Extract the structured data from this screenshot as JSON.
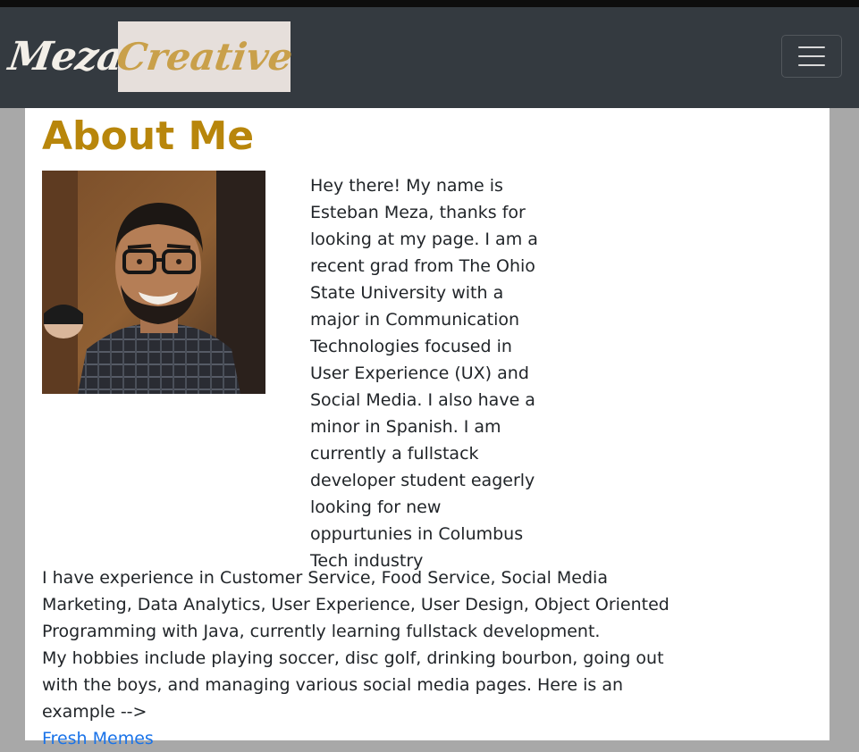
{
  "navbar": {
    "brand_part1": "Meza",
    "brand_part2": "Creative",
    "toggle_icon": "hamburger-menu-icon"
  },
  "main": {
    "title": "About Me",
    "photo_alt": "Esteban Meza",
    "bio": "Hey there! My name is Esteban Meza, thanks for looking at my page. I am a recent grad from The Ohio State University with a major in Communication Technologies focused in User Experience (UX) and Social Media. I also have a minor in Spanish. I am currently a fullstack developer student eagerly looking for new oppurtunies in Columbus Tech industry",
    "experience": "I have experience in Customer Service, Food Service, Social Media Marketing, Data Analytics, User Experience, User Design, Object Oriented Programming with Java, currently learning fullstack development.",
    "hobbies": "My hobbies include playing soccer, disc golf, drinking bourbon, going out with the boys, and managing various social media pages. Here is an example -->",
    "link_label": "Fresh Memes"
  },
  "colors": {
    "navbar_bg": "#343a40",
    "title": "#b8860b",
    "link": "#1a73e8",
    "page_bg": "#a8a8a8"
  }
}
